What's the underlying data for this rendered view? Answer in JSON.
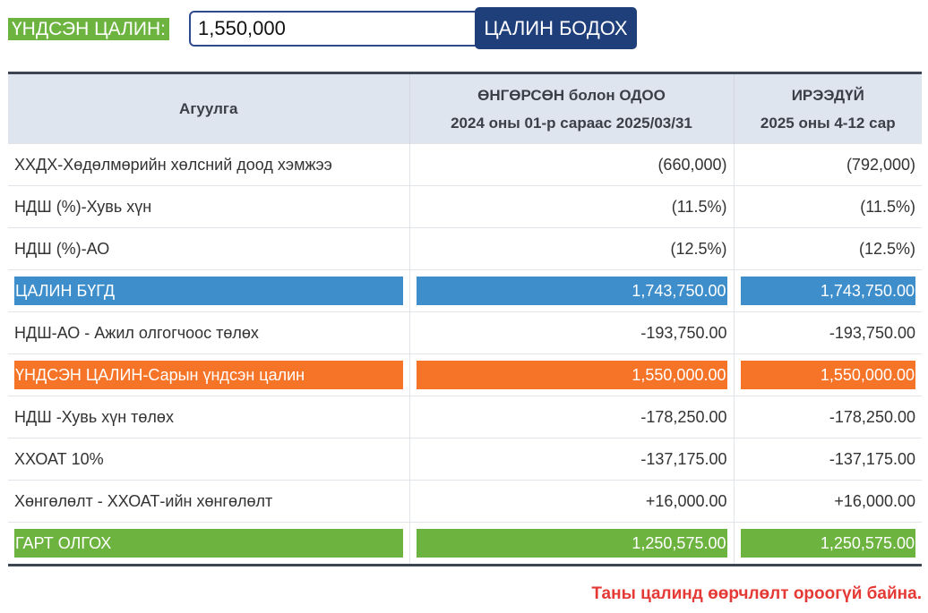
{
  "toolbar": {
    "salary_label": "ҮНДСЭН ЦАЛИН:",
    "salary_value": "1,550,000",
    "calc_button": "ЦАЛИН БОДОХ"
  },
  "table": {
    "headers": {
      "col0": "Агуулга",
      "col1_line1": "ӨНГӨРСӨН болон ОДОО",
      "col1_line2": "2024 оны 01-р сараас 2025/03/31",
      "col2_line1": "ИРЭЭДҮЙ",
      "col2_line2": "2025 оны 4-12 сар"
    },
    "rows": [
      {
        "label": "ХХДХ-Хөдөлмөрийн хөлсний доод хэмжээ",
        "past": "(660,000)",
        "future": "(792,000)"
      },
      {
        "label": "НДШ (%)-Хувь хүн",
        "past": "(11.5%)",
        "future": "(11.5%)"
      },
      {
        "label": "НДШ (%)-АО",
        "past": "(12.5%)",
        "future": "(12.5%)"
      },
      {
        "label": "ЦАЛИН БҮГД",
        "past": "1,743,750.00",
        "future": "1,743,750.00"
      },
      {
        "label": "НДШ-АО - Ажил олгогчоос төлөх",
        "past": "-193,750.00",
        "future": "-193,750.00"
      },
      {
        "label": "ҮНДСЭН ЦАЛИН-Сарын үндсэн цалин",
        "past": "1,550,000.00",
        "future": "1,550,000.00"
      },
      {
        "label": "НДШ -Хувь хүн төлөх",
        "past": "-178,250.00",
        "future": "-178,250.00"
      },
      {
        "label": "ХХОАТ 10%",
        "past": "-137,175.00",
        "future": "-137,175.00"
      },
      {
        "label": "Хөнгөлөлт - ХХОАТ-ийн хөнгөлөлт",
        "past": "+16,000.00",
        "future": "+16,000.00"
      },
      {
        "label": "ГАРТ ОЛГОХ",
        "past": "1,250,575.00",
        "future": "1,250,575.00"
      }
    ]
  },
  "status_message": "Таны цалинд өөрчлөлт ороогүй байна.",
  "colors": {
    "accent_green": "#6db33f",
    "accent_blue": "#3d8ecb",
    "accent_orange": "#f57427",
    "button_navy": "#1f3f7a",
    "negative_red": "#e53935",
    "positive_green": "#3bb33b"
  }
}
